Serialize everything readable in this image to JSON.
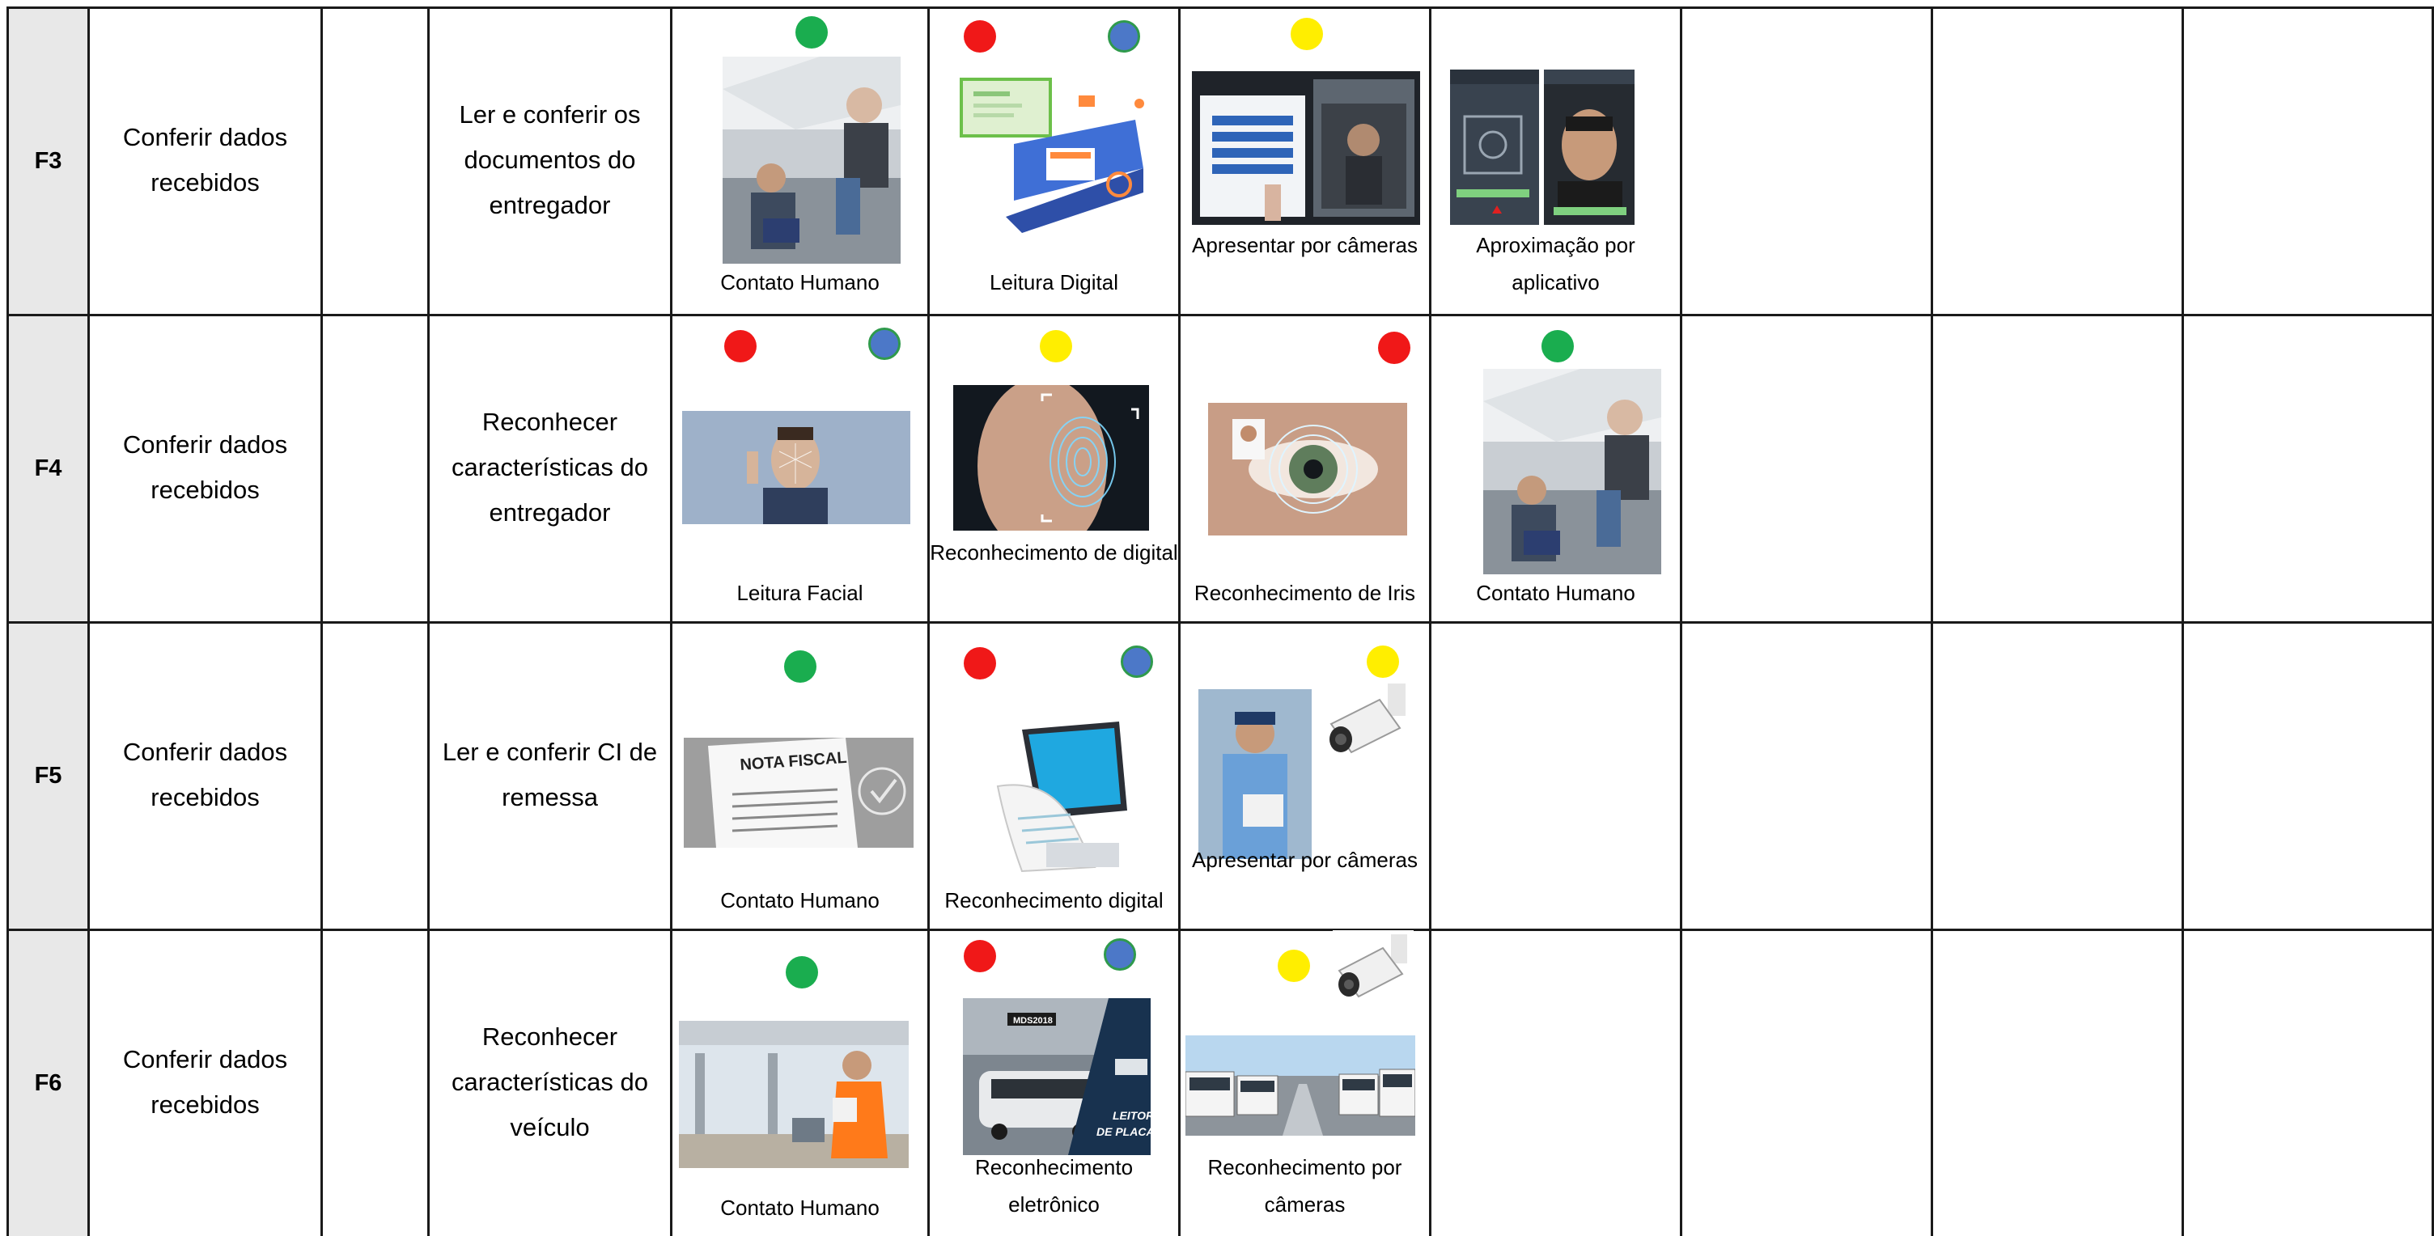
{
  "colors": {
    "green": "#1aad4f",
    "red": "#f01818",
    "yellow": "#ffee00",
    "blue": "#4c78c8",
    "id_column_bg": "#e8e8e8"
  },
  "rows": [
    {
      "id": "F3",
      "group": "Conferir dados recebidos",
      "activity": "Ler e conferir os documentos do entregador",
      "options": [
        {
          "caption": "Contato Humano",
          "markers": [
            "green"
          ],
          "image": "truck-driver-photo"
        },
        {
          "caption": "Leitura Digital",
          "markers": [
            "red",
            "blue"
          ],
          "image": "digital-document-illustration"
        },
        {
          "caption": "Apresentar por câmeras",
          "markers": [
            "yellow"
          ],
          "image": "camera-kiosk-photo"
        },
        {
          "caption": "Aproximação por aplicativo",
          "markers": [],
          "image": "face-app-screens"
        }
      ]
    },
    {
      "id": "F4",
      "group": "Conferir dados recebidos",
      "activity": "Reconhecer características do entregador",
      "options": [
        {
          "caption": "Leitura Facial",
          "markers": [
            "red",
            "blue"
          ],
          "image": "facial-scan-photo"
        },
        {
          "caption": "Reconhecimento de digital",
          "markers": [
            "yellow"
          ],
          "image": "fingerprint-photo"
        },
        {
          "caption": "Reconhecimento de Iris",
          "markers": [
            "red"
          ],
          "image": "iris-scan-photo"
        },
        {
          "caption": "Contato Humano",
          "markers": [
            "green"
          ],
          "image": "truck-driver-photo"
        }
      ]
    },
    {
      "id": "F5",
      "group": "Conferir dados recebidos",
      "activity": "Ler e conferir CI de remessa",
      "options": [
        {
          "caption": "Contato Humano",
          "markers": [
            "green"
          ],
          "image": "nota-fiscal-photo"
        },
        {
          "caption": "Reconhecimento digital",
          "markers": [
            "red",
            "blue"
          ],
          "image": "tablet-invoice-illustration"
        },
        {
          "caption": "Apresentar por câmeras",
          "markers": [
            "yellow"
          ],
          "image": "delivery-man-camera-photo"
        }
      ]
    },
    {
      "id": "F6",
      "group": "Conferir dados recebidos",
      "activity": "Reconhecer características do veículo",
      "options": [
        {
          "caption": "Contato Humano",
          "markers": [
            "green"
          ],
          "image": "gate-inspector-photo"
        },
        {
          "caption": "Reconhecimento eletrônico",
          "markers": [
            "red",
            "blue"
          ],
          "image": "plate-reader-photo",
          "image_text": [
            "MDS2018",
            "LEITOR",
            "DE PLACA"
          ]
        },
        {
          "caption": "Reconhecimento por câmeras",
          "markers": [
            "yellow"
          ],
          "image": "truck-yard-camera-photo"
        }
      ]
    }
  ],
  "images": {
    "nota_fiscal_text": "NOTA FISCAL"
  }
}
